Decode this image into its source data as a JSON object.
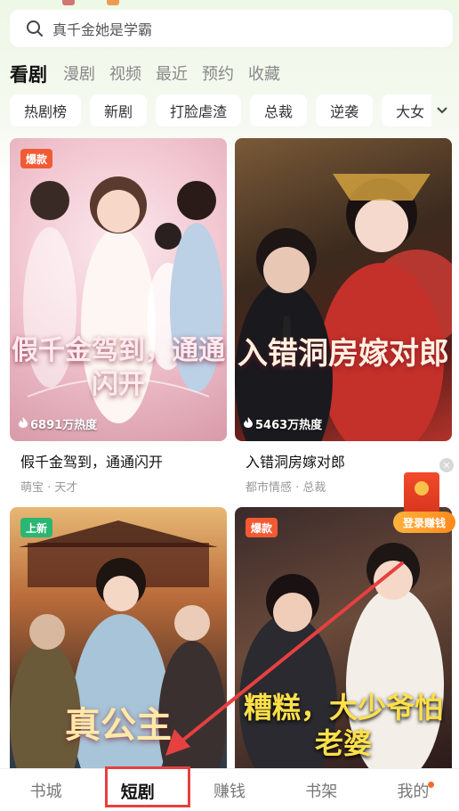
{
  "search": {
    "placeholder": "真千金她是学霸"
  },
  "tabs": [
    {
      "label": "看剧",
      "active": true
    },
    {
      "label": "漫剧"
    },
    {
      "label": "视频"
    },
    {
      "label": "最近"
    },
    {
      "label": "预约"
    },
    {
      "label": "收藏"
    }
  ],
  "chips": [
    "热剧榜",
    "新剧",
    "打脸虐渣",
    "总裁",
    "逆袭",
    "大女"
  ],
  "cards": [
    {
      "badge": "爆款",
      "heat": "6891万热度",
      "poster_text": "假千金驾到，通通闪开",
      "title": "假千金驾到，通通闪开",
      "meta": "萌宝 · 天才"
    },
    {
      "heat": "5463万热度",
      "poster_text": "入错洞房嫁对郎",
      "title": "入错洞房嫁对郎",
      "meta": "都市情感 · 总裁"
    },
    {
      "badge": "上新",
      "poster_text": "真公主"
    },
    {
      "badge": "爆款",
      "poster_text": "糟糕，大少爷怕老婆"
    }
  ],
  "reward": {
    "label": "登录赚钱"
  },
  "bottom_nav": [
    {
      "label": "书城"
    },
    {
      "label": "短剧",
      "active": true
    },
    {
      "label": "赚钱"
    },
    {
      "label": "书架"
    },
    {
      "label": "我的",
      "dot": true
    }
  ],
  "colors": {
    "accent_red": "#e64040",
    "hot_badge": "#f25a34",
    "new_badge": "#2bb673"
  }
}
